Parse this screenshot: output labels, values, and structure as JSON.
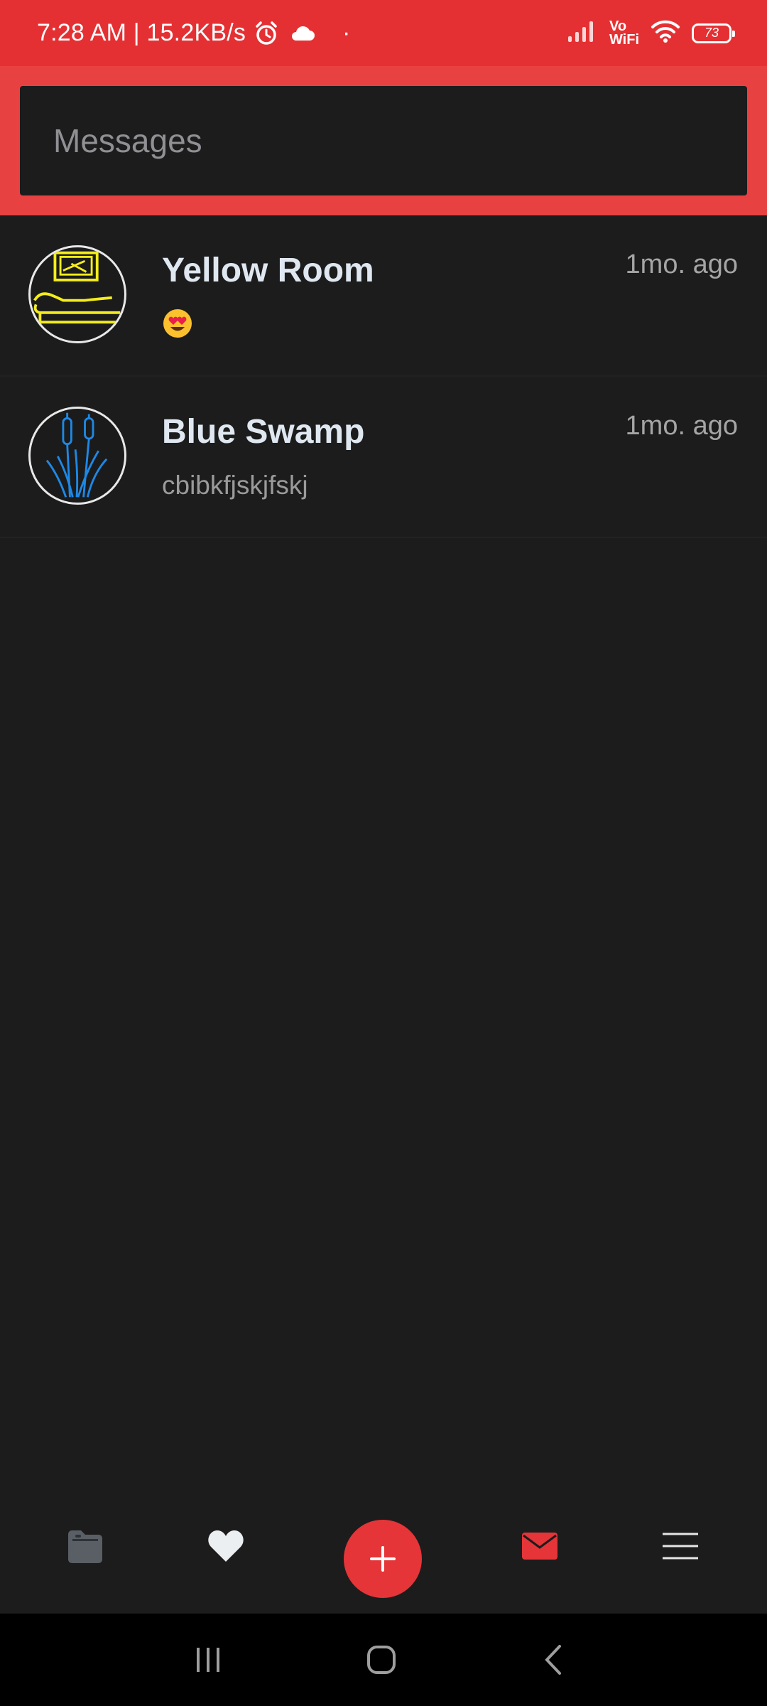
{
  "status_bar": {
    "time_speed": "7:28 AM | 15.2KB/s",
    "dot": "·",
    "vowifi_top": "Vo",
    "vowifi_bottom": "WiFi",
    "battery": "73"
  },
  "search": {
    "placeholder": "Messages"
  },
  "conversations": [
    {
      "title": "Yellow Room",
      "time": "1mo. ago",
      "preview": "😍"
    },
    {
      "title": "Blue Swamp",
      "time": "1mo. ago",
      "preview": "cbibkfjskjfskj"
    }
  ],
  "bottom_nav": {
    "fab_label": "+",
    "active_color": "#e53538",
    "inactive_icon": "folder-icon"
  },
  "colors": {
    "accent": "#e53033",
    "background": "#1c1c1c"
  }
}
